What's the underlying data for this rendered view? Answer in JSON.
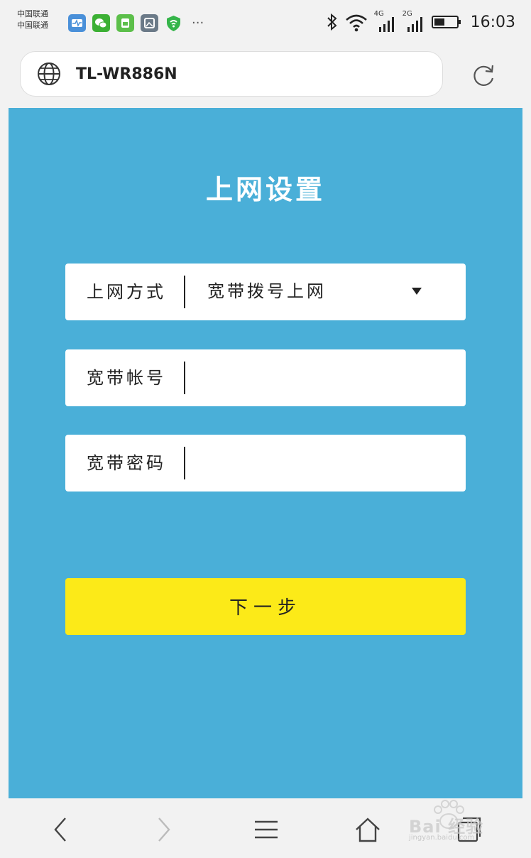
{
  "status_bar": {
    "carrier_1": "中国联通",
    "carrier_2": "中国联通",
    "network_1": "4G",
    "network_2": "2G",
    "time": "16:03",
    "app_icons": [
      "health-icon",
      "wechat-icon",
      "sim-manager-icon",
      "gallery-icon",
      "shield-icon"
    ],
    "more": "···"
  },
  "browser": {
    "url": "TL-WR886N"
  },
  "page": {
    "title": "上网设置",
    "connection_type": {
      "label": "上网方式",
      "value": "宽带拨号上网"
    },
    "account": {
      "label": "宽带帐号",
      "value": ""
    },
    "password": {
      "label": "宽带密码",
      "value": ""
    },
    "next_button": "下一步"
  },
  "watermark": {
    "brand": "Bai 经验",
    "sub": "jingyan.baidu.com"
  },
  "colors": {
    "page_background": "#4aafd8",
    "button": "#fcea18",
    "field": "#ffffff"
  }
}
